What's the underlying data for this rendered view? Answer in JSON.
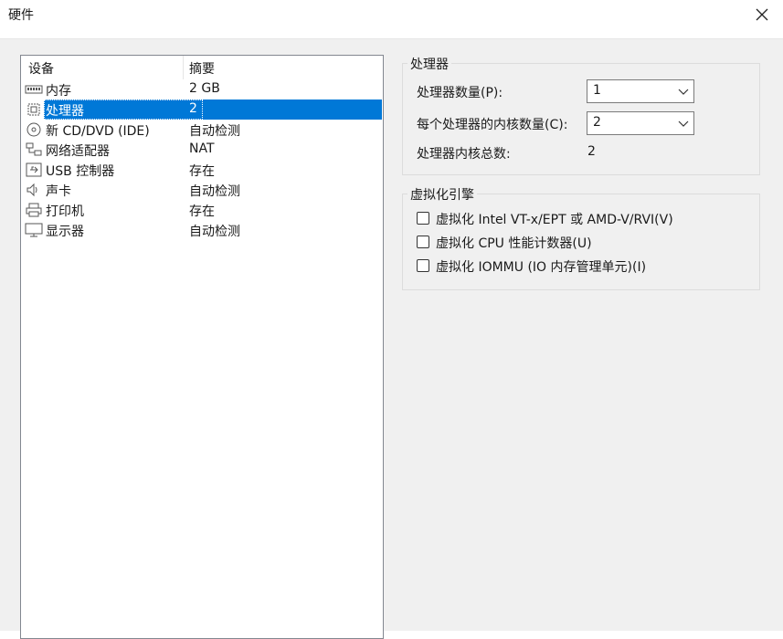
{
  "window": {
    "title": "硬件"
  },
  "device_list": {
    "columns": [
      "设备",
      "摘要"
    ],
    "rows": [
      {
        "name": "内存",
        "summary": "2 GB",
        "icon": "memory-icon"
      },
      {
        "name": "处理器",
        "summary": "2",
        "icon": "processor-icon",
        "selected": true
      },
      {
        "name": "新 CD/DVD (IDE)",
        "summary": "自动检测",
        "icon": "cd-dvd-icon"
      },
      {
        "name": "网络适配器",
        "summary": "NAT",
        "icon": "network-adapter-icon"
      },
      {
        "name": "USB 控制器",
        "summary": "存在",
        "icon": "usb-icon"
      },
      {
        "name": "声卡",
        "summary": "自动检测",
        "icon": "speaker-icon"
      },
      {
        "name": "打印机",
        "summary": "存在",
        "icon": "printer-icon"
      },
      {
        "name": "显示器",
        "summary": "自动检测",
        "icon": "monitor-icon"
      }
    ]
  },
  "processor_group": {
    "title": "处理器",
    "count_label": "处理器数量(P):",
    "count_value": "1",
    "cores_label": "每个处理器的内核数量(C):",
    "cores_value": "2",
    "total_label": "处理器内核总数:",
    "total_value": "2"
  },
  "virtualization_group": {
    "title": "虚拟化引擎",
    "options": [
      {
        "label": "虚拟化 Intel VT-x/EPT 或 AMD-V/RVI(V)",
        "checked": false
      },
      {
        "label": "虚拟化 CPU 性能计数器(U)",
        "checked": false
      },
      {
        "label": "虚拟化 IOMMU (IO 内存管理单元)(I)",
        "checked": false
      }
    ]
  },
  "colors": {
    "selection": "#0078d7",
    "background": "#f0f0f0"
  }
}
